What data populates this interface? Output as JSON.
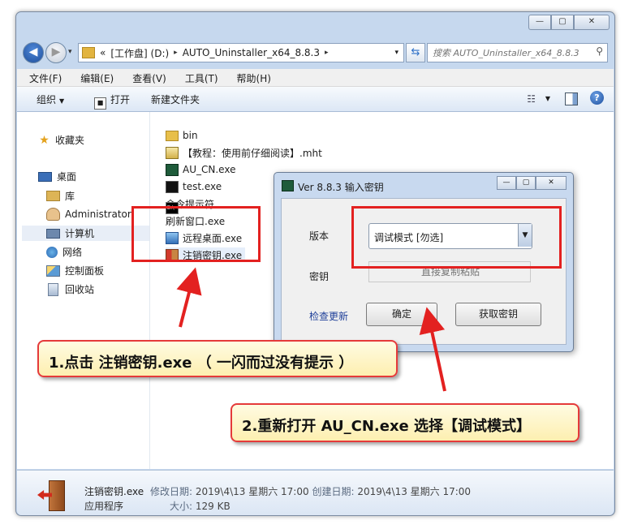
{
  "window": {
    "caption": {
      "minimize": "—",
      "maximize": "▢",
      "close": "✕"
    },
    "address": {
      "prefix": "«",
      "segments": [
        "[工作盘] (D:)",
        "AUTO_Uninstaller_x64_8.8.3"
      ],
      "separator": "▸"
    },
    "search_placeholder": "搜索 AUTO_Uninstaller_x64_8.8.3"
  },
  "menu": [
    "文件(F)",
    "编辑(E)",
    "查看(V)",
    "工具(T)",
    "帮助(H)"
  ],
  "toolbar": {
    "organize": "组织",
    "open": "打开",
    "new_folder": "新建文件夹"
  },
  "nav": {
    "favorites": "收藏夹",
    "desktop": "桌面",
    "library": "库",
    "admin": "Administrator",
    "computer": "计算机",
    "network": "网络",
    "control_panel": "控制面板",
    "recycle": "回收站"
  },
  "files": [
    {
      "name": "bin",
      "icon": "folder-icon"
    },
    {
      "name": "【教程：使用前仔细阅读】.mht",
      "icon": "mht-file-icon"
    },
    {
      "name": "AU_CN.exe",
      "icon": "au-app-icon"
    },
    {
      "name": "test.exe",
      "icon": "console-icon"
    },
    {
      "name": "命令提示符",
      "icon": "cmd-icon"
    },
    {
      "name": "刷新窗口.exe",
      "icon": "refresh-app-icon"
    },
    {
      "name": "远程桌面.exe",
      "icon": "remote-desktop-icon"
    },
    {
      "name": "注销密钥.exe",
      "icon": "uninstall-key-icon"
    }
  ],
  "details": {
    "name": "注销密钥.exe",
    "type": "应用程序",
    "modified_label": "修改日期:",
    "modified": "2019\\4\\13 星期六 17:00",
    "created_label": "创建日期:",
    "created": "2019\\4\\13 星期六 17:00",
    "size_label": "大小:",
    "size": "129 KB"
  },
  "dialog": {
    "title": "Ver 8.8.3 输入密钥",
    "version_label": "版本",
    "version_value": "调试模式 [勿选]",
    "key_label": "密钥",
    "key_placeholder": "直接复制粘贴",
    "check_update": "检查更新",
    "ok": "确定",
    "get_key": "获取密钥"
  },
  "callouts": {
    "step1": "1.点击 注销密钥.exe （ 一闪而过没有提示 ）",
    "step2": "2.重新打开 AU_CN.exe 选择【调试模式】"
  },
  "colors": {
    "annotation_red": "#e32120",
    "callout_bg": "#fdf3c0",
    "window_frame": "#c6d8ee"
  }
}
